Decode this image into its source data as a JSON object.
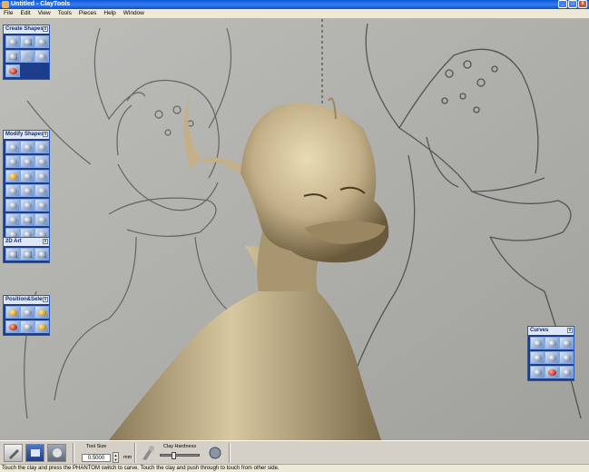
{
  "window": {
    "title": "Untitled - ClayTools",
    "minimize": "_",
    "maximize": "□",
    "close": "x"
  },
  "menu": [
    "File",
    "Edit",
    "View",
    "Tools",
    "Pieces",
    "Help",
    "Window"
  ],
  "panels": {
    "create_shapes": {
      "title": "Create Shapes"
    },
    "modify_shapes": {
      "title": "Modify Shapes"
    },
    "art_2d": {
      "title": "2D Art"
    },
    "position_select": {
      "title": "Position&Selec"
    },
    "curves": {
      "title": "Curves"
    }
  },
  "toolbar": {
    "tool_size_label": "Tool Size",
    "tool_size_value": "0.5000",
    "tool_size_unit": "mm",
    "clay_hardness_label": "Clay Hardness"
  },
  "status": "Touch the clay and press the PHANTOM switch to carve. Touch the clay and push through to touch from other side.",
  "colors": {
    "accent": "#2a58b8",
    "clay": "#c8b890",
    "sketch_bg": "#a9a9a6"
  },
  "icons": {
    "close": "x",
    "spin_up": "▲",
    "spin_down": "▼"
  }
}
